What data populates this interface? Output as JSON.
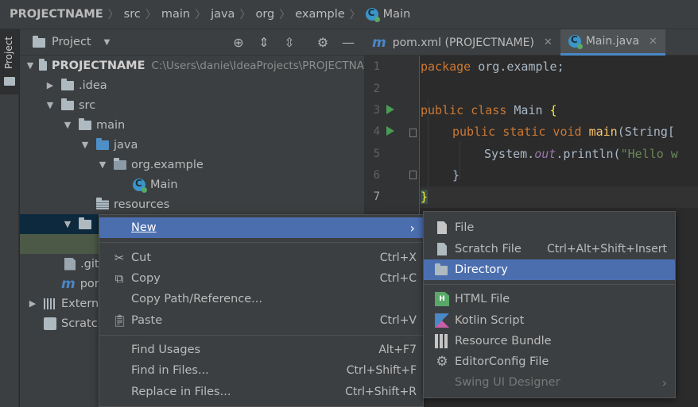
{
  "breadcrumb": {
    "project": "PROJECTNAME",
    "items": [
      "src",
      "main",
      "java",
      "org",
      "example"
    ],
    "current": "Main"
  },
  "stripe": {
    "label": "Project"
  },
  "project_panel": {
    "title": "Project"
  },
  "tabs": [
    {
      "label": "pom.xml (PROJECTNAME)"
    },
    {
      "label": "Main.java"
    }
  ],
  "tree": {
    "root_name": "PROJECTNAME",
    "root_path": "C:\\Users\\danie\\IdeaProjects\\PROJECTNA",
    "idea": ".idea",
    "src": "src",
    "main": "main",
    "java": "java",
    "package": "org.example",
    "main_class": "Main",
    "resources": "resources",
    "gitignore": ".giti",
    "pom": "pom",
    "external": "Externa",
    "scratches": "Scratch"
  },
  "gutter": {
    "lines": [
      "1",
      "2",
      "3",
      "4",
      "5",
      "6",
      "7"
    ]
  },
  "code": {
    "l1_kw": "package",
    "l1_rest": " org.example;",
    "l3_kw": "public class",
    "l3_name": " Main ",
    "l3_brace": "{",
    "l4_kw": "public static void",
    "l4_fn": " main",
    "l4_rest": "(String[",
    "l5_a": "System.",
    "l5_field": "out",
    "l5_b": ".println(",
    "l5_str": "\"Hello w",
    "l6": "}",
    "l7": "}"
  },
  "context_menu": {
    "new": "New",
    "cut": "Cut",
    "cut_sc": "Ctrl+X",
    "copy": "Copy",
    "copy_sc": "Ctrl+C",
    "copy_path": "Copy Path/Reference...",
    "paste": "Paste",
    "paste_sc": "Ctrl+V",
    "find_usages": "Find Usages",
    "find_usages_sc": "Alt+F7",
    "find_in_files": "Find in Files...",
    "find_in_files_sc": "Ctrl+Shift+F",
    "replace_in_files": "Replace in Files...",
    "replace_in_files_sc": "Ctrl+Shift+R"
  },
  "submenu": {
    "file": "File",
    "scratch_file": "Scratch File",
    "scratch_file_sc": "Ctrl+Alt+Shift+Insert",
    "directory": "Directory",
    "html_file": "HTML File",
    "kotlin_script": "Kotlin Script",
    "resource_bundle": "Resource Bundle",
    "editorconfig_file": "EditorConfig File",
    "swing_ui_designer": "Swing UI Designer"
  },
  "colors": {
    "selection": "#4b6eaf",
    "background": "#2b2b2b",
    "panel": "#3c3f41",
    "keyword": "#cc7832",
    "string": "#6a8759"
  }
}
